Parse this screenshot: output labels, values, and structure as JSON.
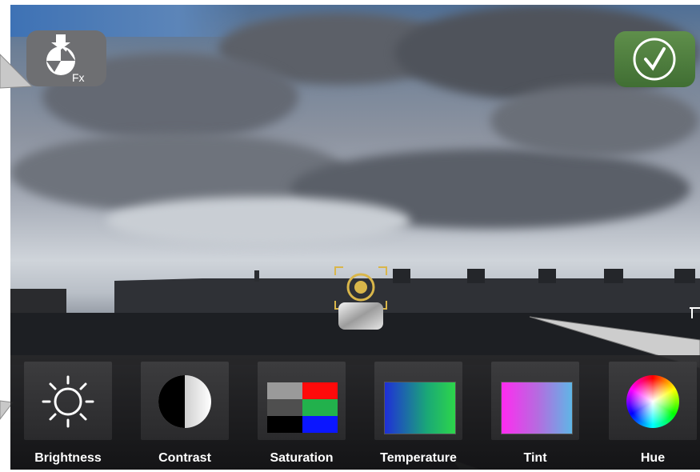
{
  "app": {
    "logo_icon": "fx-camera-icon",
    "done_icon": "checkmark-icon",
    "focus_icon": "exposure-focus-target-icon",
    "accent_done": "#4f7f3c"
  },
  "toolbar": {
    "items": [
      {
        "label": "Brightness",
        "icon": "sun-icon"
      },
      {
        "label": "Contrast",
        "icon": "contrast-circle-icon"
      },
      {
        "label": "Saturation",
        "icon": "saturation-swatch-icon"
      },
      {
        "label": "Temperature",
        "icon": "temperature-gradient-icon"
      },
      {
        "label": "Tint",
        "icon": "tint-gradient-icon"
      },
      {
        "label": "Hue",
        "icon": "color-wheel-icon"
      }
    ]
  }
}
